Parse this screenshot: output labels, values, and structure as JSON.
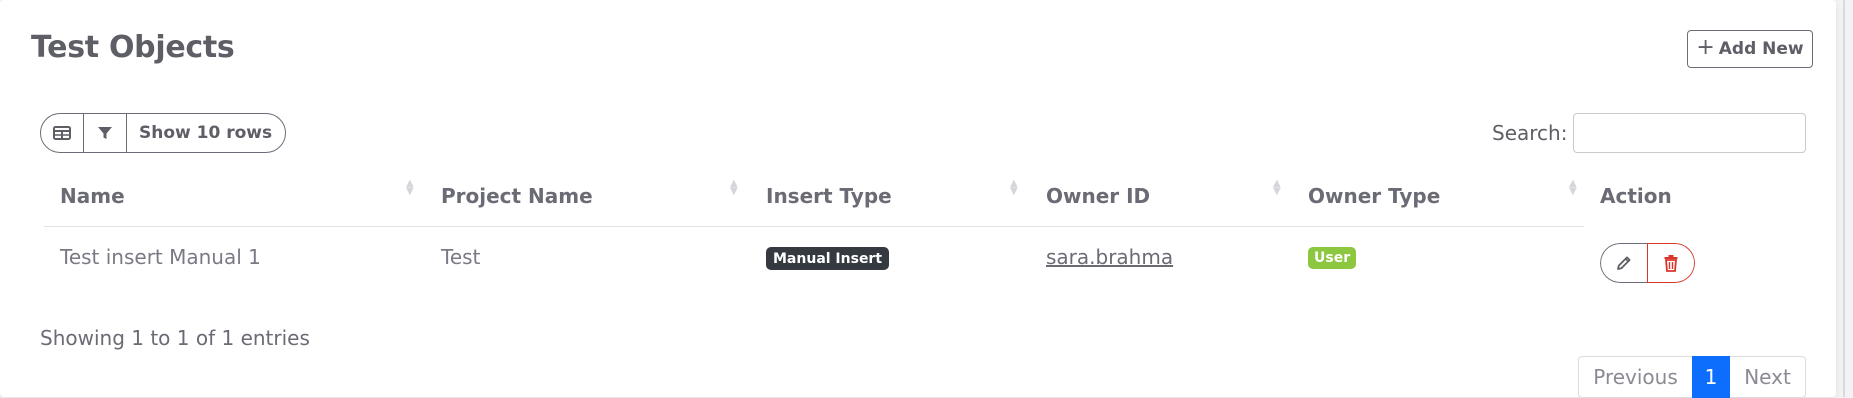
{
  "page": {
    "title": "Test Objects"
  },
  "toolbar": {
    "add_label": "Add New",
    "show_rows_label": "Show 10 rows",
    "search_label": "Search:",
    "search_value": ""
  },
  "table": {
    "columns": [
      "Name",
      "Project Name",
      "Insert Type",
      "Owner ID",
      "Owner Type",
      "Action"
    ],
    "rows": [
      {
        "name": "Test insert Manual 1",
        "project_name": "Test",
        "insert_type": "Manual Insert",
        "owner_id": "sara.brahma",
        "owner_type": "User"
      }
    ]
  },
  "footer": {
    "info": "Showing 1 to 1 of 1 entries",
    "pagination": {
      "previous": "Previous",
      "current": "1",
      "next": "Next"
    }
  },
  "colors": {
    "insert_badge": "#343a40",
    "user_badge": "#8dc63f",
    "delete": "#d9352b",
    "page_active": "#0d6efd"
  }
}
